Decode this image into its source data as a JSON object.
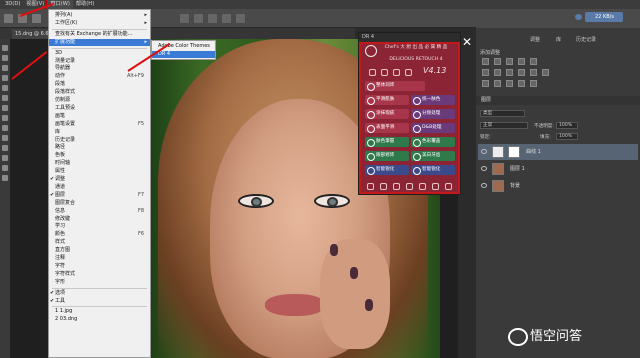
{
  "menubar": {
    "items": [
      "3D(D)",
      "视图(V)",
      "窗口(W)",
      "帮助(H)"
    ],
    "active_index": 2
  },
  "document": {
    "tab": "15.dng @ 6.67%"
  },
  "window_menu": {
    "items": [
      {
        "label": "排列(A)",
        "submenu": true
      },
      {
        "label": "工作区(K)",
        "submenu": true
      },
      {
        "sep": true
      },
      {
        "label": "查找有关 Exchange 的扩展功能..."
      },
      {
        "label": "扩展功能",
        "submenu": true,
        "highlight": true
      },
      {
        "sep": true
      },
      {
        "label": "3D"
      },
      {
        "label": "测量记录"
      },
      {
        "label": "导航器"
      },
      {
        "label": "动作",
        "shortcut": "Alt+F9"
      },
      {
        "label": "段落"
      },
      {
        "label": "段落样式"
      },
      {
        "label": "仿制源"
      },
      {
        "label": "工具预设"
      },
      {
        "label": "画笔"
      },
      {
        "label": "画笔设置",
        "shortcut": "F5"
      },
      {
        "label": "库"
      },
      {
        "label": "历史记录"
      },
      {
        "label": "路径"
      },
      {
        "label": "色板"
      },
      {
        "label": "时间轴"
      },
      {
        "label": "属性"
      },
      {
        "label": "调整",
        "checked": true
      },
      {
        "label": "通道"
      },
      {
        "label": "图层",
        "checked": true,
        "shortcut": "F7"
      },
      {
        "label": "图层复合"
      },
      {
        "label": "信息",
        "shortcut": "F8"
      },
      {
        "label": "修改键"
      },
      {
        "label": "学习"
      },
      {
        "label": "颜色",
        "shortcut": "F6"
      },
      {
        "label": "样式"
      },
      {
        "label": "直方图"
      },
      {
        "label": "注释"
      },
      {
        "label": "字符"
      },
      {
        "label": "字符样式"
      },
      {
        "label": "字形"
      },
      {
        "sep": true
      },
      {
        "label": "选项",
        "checked": true
      },
      {
        "label": "工具",
        "checked": true
      },
      {
        "sep": true
      },
      {
        "label": "1 1.jpg"
      },
      {
        "label": "2 03.dng"
      }
    ]
  },
  "extensions_submenu": {
    "items": [
      {
        "label": "Adobe Color Themes"
      },
      {
        "label": "DR 4",
        "checked": true,
        "highlight": true
      }
    ]
  },
  "dr4": {
    "header": "DR 4",
    "title": "Chef's 大 厨 出 品 必 属 精 品",
    "subtitle": "DELICIOUS RETOUCH 4",
    "version": "V4.13",
    "buttons": [
      {
        "label": "整体润饰",
        "color": "#a8364a"
      },
      {
        "label": "平滑肌肤",
        "color": "#a8364a"
      },
      {
        "label": "统一肤色",
        "color": "#6a3a7a"
      },
      {
        "label": "涂抹瑕疵",
        "color": "#a8364a"
      },
      {
        "label": "分频处理",
        "color": "#6a3a7a"
      },
      {
        "label": "表面平滑",
        "color": "#a8364a"
      },
      {
        "label": "D&B处理",
        "color": "#6a3a7a"
      },
      {
        "label": "肤色掌握",
        "color": "#2f7a4a"
      },
      {
        "label": "色彩覆盖",
        "color": "#2f7a4a"
      },
      {
        "label": "眼部修饰",
        "color": "#2f7a4a"
      },
      {
        "label": "美白牙齿",
        "color": "#2f7a4a"
      },
      {
        "label": "智能锐化",
        "color": "#3a4a8a"
      },
      {
        "label": "智能锐化",
        "color": "#3a4a8a"
      }
    ]
  },
  "right_panel": {
    "storage": "22 KB/s",
    "adjust_title": "添加调整",
    "tabs": [
      "调整",
      "库",
      "历史记录"
    ],
    "layers_title": "图层",
    "kind_label": "类型",
    "blend_mode": "正常",
    "opacity_label": "不透明度:",
    "opacity": "100%",
    "lock_label": "锁定:",
    "fill_label": "填充:",
    "fill": "100%",
    "layers": [
      {
        "name": "曲线 1",
        "selected": true
      },
      {
        "name": "图层 1"
      },
      {
        "name": "背景"
      }
    ]
  },
  "watermark": "悟空问答"
}
